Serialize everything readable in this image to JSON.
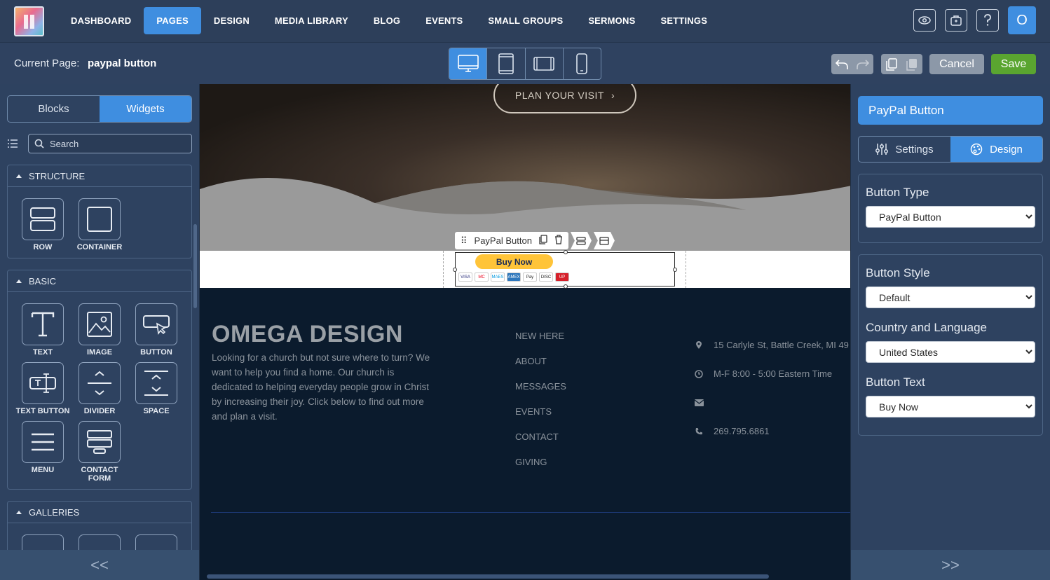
{
  "nav": {
    "items": [
      "DASHBOARD",
      "PAGES",
      "DESIGN",
      "MEDIA LIBRARY",
      "BLOG",
      "EVENTS",
      "SMALL GROUPS",
      "SERMONS",
      "SETTINGS"
    ],
    "active": "PAGES",
    "avatar_initial": "O"
  },
  "pagebar": {
    "label": "Current Page:",
    "page_name": "paypal button",
    "cancel_label": "Cancel",
    "save_label": "Save"
  },
  "left": {
    "tabs": [
      "Blocks",
      "Widgets"
    ],
    "active_tab": "Widgets",
    "search_placeholder": "Search",
    "sections": [
      {
        "title": "STRUCTURE",
        "widgets": [
          "ROW",
          "CONTAINER"
        ]
      },
      {
        "title": "BASIC",
        "widgets": [
          "TEXT",
          "IMAGE",
          "BUTTON",
          "TEXT BUTTON",
          "DIVIDER",
          "SPACE",
          "MENU",
          "CONTACT FORM"
        ]
      },
      {
        "title": "GALLERIES",
        "widgets": []
      }
    ],
    "collapse_glyph": "<<"
  },
  "canvas": {
    "hero_button": "PLAN YOUR VISIT",
    "widget_toolbar_label": "PayPal Button",
    "paypal_button_text": "Buy Now",
    "cards": [
      "VISA",
      "MC",
      "MAES",
      "AMEX",
      "Pay",
      "DISC",
      "UP"
    ],
    "footer": {
      "title": "OMEGA DESIGN",
      "text": "Looking for a church but not sure where to turn? We want to help you find a home. Our church is dedicated to helping everyday people grow in Christ by increasing their joy.  Click below to find out more and plan a visit.",
      "links": [
        "NEW HERE",
        "ABOUT",
        "MESSAGES",
        "EVENTS",
        "CONTACT",
        "GIVING"
      ],
      "address": "15 Carlyle St, Battle Creek, MI 49",
      "hours": "M-F 8:00 - 5:00 Eastern Time",
      "email": "",
      "phone": "269.795.6861"
    }
  },
  "right": {
    "title": "PayPal Button",
    "tabs": [
      "Settings",
      "Design"
    ],
    "active_tab": "Design",
    "button_type_label": "Button Type",
    "button_type_value": "PayPal Button",
    "button_style_label": "Button Style",
    "button_style_value": "Default",
    "country_label": "Country and Language",
    "country_value": "United States",
    "button_text_label": "Button Text",
    "button_text_value": "Buy Now",
    "expand_glyph": ">>"
  },
  "colors": {
    "accent": "#3f8ee0",
    "save": "#5aa530",
    "paypal_yellow": "#ffc439"
  }
}
